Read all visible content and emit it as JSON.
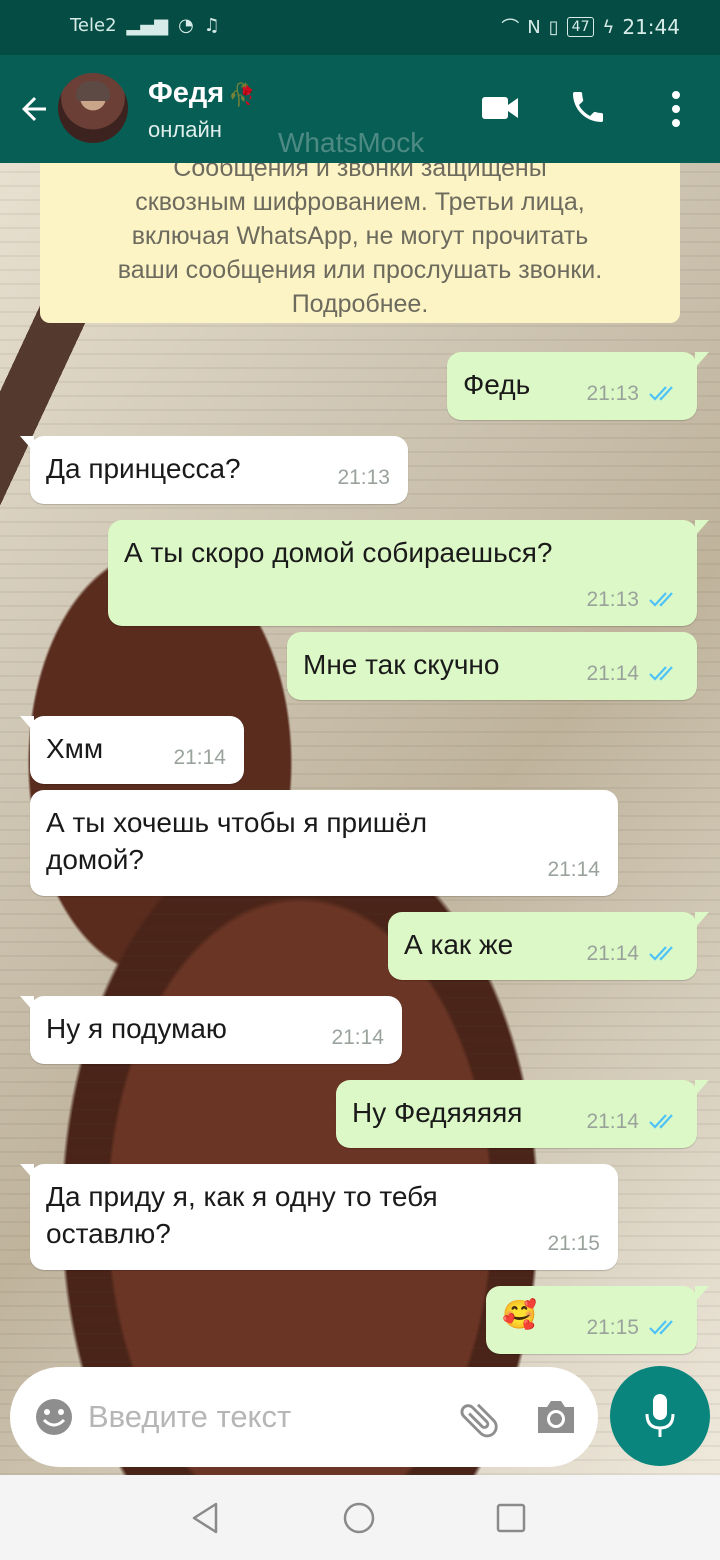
{
  "status_bar": {
    "carrier": "Tele2",
    "battery": "47",
    "time": "21:44"
  },
  "header": {
    "contact_name": "Федя",
    "contact_emoji": "🥀",
    "contact_status": "онлайн",
    "watermark": "WhatsMock"
  },
  "encryption_notice": {
    "lines": [
      "Сообщения и звонки защищены",
      "сквозным шифрованием. Третьи лица,",
      "включая WhatsApp, не могут прочитать",
      "ваши сообщения или прослушать звонки.",
      "Подробнее."
    ]
  },
  "messages": [
    {
      "direction": "out",
      "text": "Федь",
      "time": "21:13",
      "status": "read"
    },
    {
      "direction": "in",
      "text": "Да принцесса?",
      "time": "21:13"
    },
    {
      "direction": "out",
      "text": "А ты скоро домой собираешься?",
      "time": "21:13",
      "status": "read"
    },
    {
      "direction": "out",
      "text": "Мне так скучно",
      "time": "21:14",
      "status": "read"
    },
    {
      "direction": "in",
      "text": "Хмм",
      "time": "21:14"
    },
    {
      "direction": "in",
      "text": "А ты хочешь чтобы я пришёл\nдомой?",
      "time": "21:14"
    },
    {
      "direction": "out",
      "text": "А как же",
      "time": "21:14",
      "status": "read"
    },
    {
      "direction": "in",
      "text": "Ну я подумаю",
      "time": "21:14"
    },
    {
      "direction": "out",
      "text": "Ну Федяяяяя",
      "time": "21:14",
      "status": "read"
    },
    {
      "direction": "in",
      "text": "Да приду я, как я одну то тебя\nоставлю?",
      "time": "21:15"
    },
    {
      "direction": "out",
      "text": "🥰",
      "time": "21:15",
      "status": "read"
    }
  ],
  "input": {
    "placeholder": "Введите текст"
  },
  "icons": [
    "back-arrow-icon",
    "video-call-icon",
    "phone-icon",
    "more-vert-icon",
    "smiley-icon",
    "paperclip-icon",
    "camera-icon",
    "mic-icon"
  ],
  "colors": {
    "header": "#075e54",
    "status_bar": "#054d44",
    "outgoing_bubble": "#dcf8c6",
    "incoming_bubble": "#ffffff",
    "encryption_banner": "#fdf4c5",
    "read_ticks": "#4fc3f7",
    "mic_button": "#09857d"
  }
}
